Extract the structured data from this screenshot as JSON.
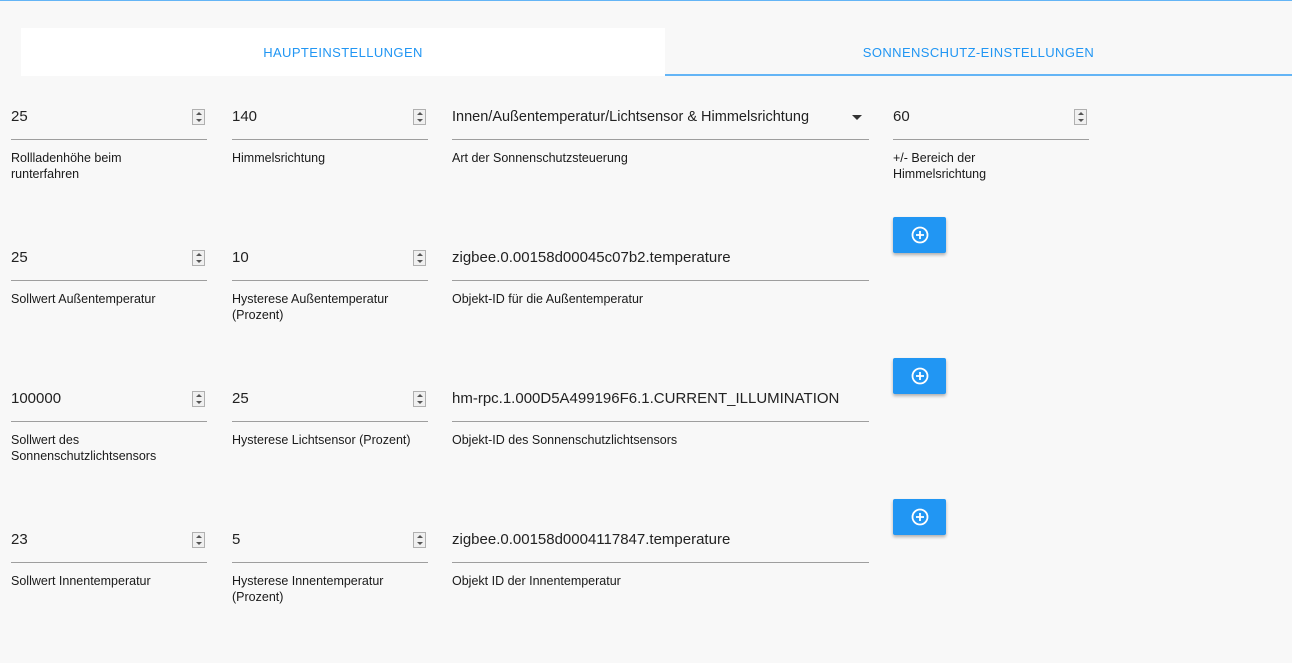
{
  "tabs": [
    {
      "label": "Haupteinstellungen",
      "active": false
    },
    {
      "label": "Sonnenschutz-Einstellungen",
      "active": true
    }
  ],
  "colors": {
    "accent": "#2196f3",
    "tab_underline": "#64b5f6"
  },
  "rows": [
    {
      "fields": [
        {
          "value": "25",
          "label": "Rollladenhöhe beim runterfahren",
          "type": "number"
        },
        {
          "value": "140",
          "label": "Himmelsrichtung",
          "type": "number"
        },
        {
          "value": "Innen/Außentemperatur/Lichtsensor & Himmelsrichtung",
          "label": "Art der Sonnenschutzsteuerung",
          "type": "select"
        },
        {
          "value": "60",
          "label": "+/- Bereich der Himmelsrichtung",
          "type": "number"
        }
      ]
    },
    {
      "fields": [
        {
          "value": "25",
          "label": "Sollwert Außentemperatur",
          "type": "number"
        },
        {
          "value": "10",
          "label": "Hysterese Außentemperatur (Prozent)",
          "type": "number"
        },
        {
          "value": "zigbee.0.00158d00045c07b2.temperature",
          "label": "Objekt-ID für die Außentemperatur",
          "type": "text"
        }
      ],
      "add_button_icon": "plus-circle-icon"
    },
    {
      "fields": [
        {
          "value": "100000",
          "label": "Sollwert des Sonnenschutzlichtsensors",
          "type": "number"
        },
        {
          "value": "25",
          "label": "Hysterese Lichtsensor (Prozent)",
          "type": "number"
        },
        {
          "value": "hm-rpc.1.000D5A499196F6.1.CURRENT_ILLUMINATION",
          "label": "Objekt-ID des Sonnenschutzlichtsensors",
          "type": "text"
        }
      ],
      "add_button_icon": "plus-circle-icon"
    },
    {
      "fields": [
        {
          "value": "23",
          "label": "Sollwert Innentemperatur",
          "type": "number"
        },
        {
          "value": "5",
          "label": "Hysterese Innentemperatur (Prozent)",
          "type": "number"
        },
        {
          "value": "zigbee.0.00158d0004117847.temperature",
          "label": "Objekt ID der Innentemperatur",
          "type": "text"
        }
      ],
      "add_button_icon": "plus-circle-icon"
    }
  ]
}
